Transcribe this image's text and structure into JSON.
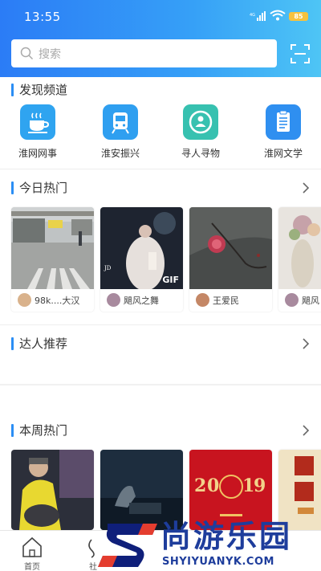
{
  "status": {
    "time": "13:55",
    "battery": "85"
  },
  "search": {
    "placeholder": "搜索"
  },
  "discover": {
    "title": "发现频道",
    "items": [
      {
        "label": "淮网网事",
        "icon": "coffee-cup-icon",
        "color": "#2fa4f0"
      },
      {
        "label": "淮安振兴",
        "icon": "train-icon",
        "color": "#2f9ff0"
      },
      {
        "label": "寻人寻物",
        "icon": "person-search-icon",
        "color": "#37c1b0"
      },
      {
        "label": "淮网文学",
        "icon": "document-icon",
        "color": "#2f8ff0"
      }
    ]
  },
  "today_hot": {
    "title": "今日热门",
    "cards": [
      {
        "author": "98k....大汉"
      },
      {
        "author": "飓风之舞",
        "badge": "GIF"
      },
      {
        "author": "王爱民"
      },
      {
        "author": "飓风"
      }
    ]
  },
  "experts": {
    "title": "达人推荐"
  },
  "week_hot": {
    "title": "本周热门"
  },
  "tabbar": {
    "items": [
      {
        "label": "首页"
      },
      {
        "label": "社"
      }
    ]
  },
  "watermark": {
    "text": "尚游乐园",
    "subtext": "SHYIYUANYK.COM"
  },
  "colors": {
    "accent": "#2b8ef5",
    "header_start": "#2b7cf6",
    "header_end": "#4ec5f5"
  }
}
